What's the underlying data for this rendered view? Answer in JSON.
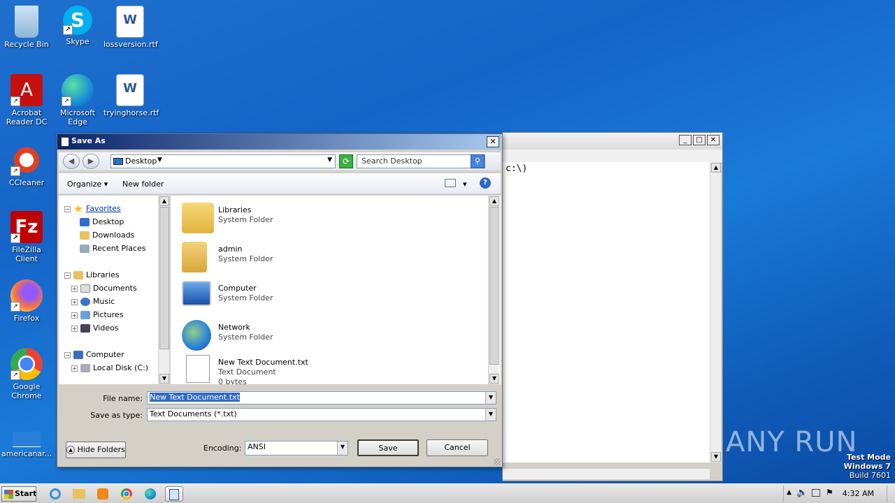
{
  "desktop": {
    "icons": [
      {
        "label": "Recycle Bin"
      },
      {
        "label": "Skype"
      },
      {
        "label": "lossversion.rtf"
      },
      {
        "label": "Acrobat Reader DC"
      },
      {
        "label": "Microsoft Edge"
      },
      {
        "label": "tryinghorse.rtf"
      },
      {
        "label": "CCleaner"
      },
      {
        "label": "FileZilla Client"
      },
      {
        "label": "Firefox"
      },
      {
        "label": "Google Chrome"
      },
      {
        "label": "americanar..."
      }
    ],
    "watermark": "ANY RUN",
    "test_mode": {
      "line1": "Test Mode",
      "line2": "Windows 7",
      "line3": "Build 7601"
    }
  },
  "notepad": {
    "content": "c:\\)"
  },
  "dialog": {
    "title": "Save As",
    "address": "Desktop",
    "search_placeholder": "Search Desktop",
    "toolbar": {
      "organize": "Organize",
      "new_folder": "New folder"
    },
    "nav": {
      "favorites": "Favorites",
      "desktop": "Desktop",
      "downloads": "Downloads",
      "recent_places": "Recent Places",
      "libraries": "Libraries",
      "documents": "Documents",
      "music": "Music",
      "pictures": "Pictures",
      "videos": "Videos",
      "computer": "Computer",
      "local_disk": "Local Disk (C:)"
    },
    "files": [
      {
        "name": "Libraries",
        "type": "System Folder"
      },
      {
        "name": "admin",
        "type": "System Folder"
      },
      {
        "name": "Computer",
        "type": "System Folder"
      },
      {
        "name": "Network",
        "type": "System Folder"
      },
      {
        "name": "New Text Document.txt",
        "type": "Text Document",
        "size": "0 bytes"
      }
    ],
    "file_name_label": "File name:",
    "file_name_value": "New Text Document.txt",
    "save_type_label": "Save as type:",
    "save_type_value": "Text Documents (*.txt)",
    "hide_folders": "Hide Folders",
    "encoding_label": "Encoding:",
    "encoding_value": "ANSI",
    "save": "Save",
    "cancel": "Cancel"
  },
  "taskbar": {
    "start": "Start",
    "clock": "4:32 AM"
  },
  "colors": {
    "desktop": "#1565c8",
    "titlebar": "#0a246a",
    "selection": "#316ac5"
  }
}
